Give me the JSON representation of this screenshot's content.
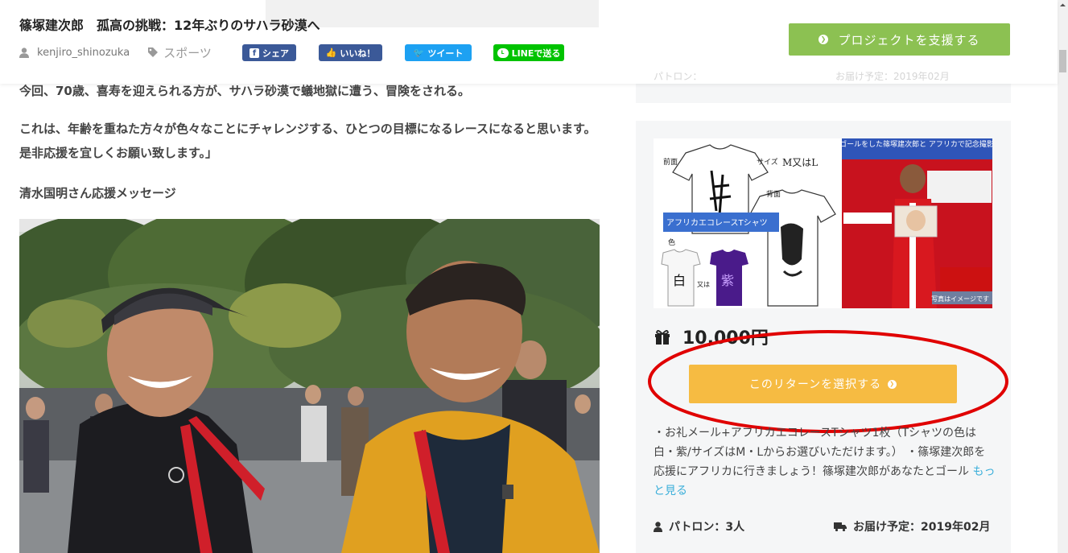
{
  "header": {
    "title": "篠塚建次郎　孤高の挑戦：12年ぶりのサハラ砂漠へ",
    "author": "kenjiro_shinozuka",
    "category": "スポーツ",
    "share_facebook": "シェア",
    "share_like": "いいね！",
    "share_tweet": "ツイート",
    "share_line": "LINEで送る",
    "support_button": "プロジェクトを支援する"
  },
  "article": {
    "paragraph1": "今回、70歳、喜寿を迎えられる方が、サハラ砂漠で蟻地獄に遭う、冒険をされる。",
    "paragraph2": "これは、年齢を重ねた方々が色々なことにチャレンジする、ひとつの目標になるレースになると思います。是非応援を宜しくお願い致します。」",
    "subheading": "清水国明さん応援メッセージ"
  },
  "sidebar_faded": {
    "text": "",
    "patron": "パトロン：",
    "delivery": "お届け予定：2019年02月"
  },
  "reward": {
    "image": {
      "front_label": "前面",
      "size_label": "サイズ",
      "size_value": "M又はL",
      "back_label": "背面",
      "shirt_banner": "アフリカエコレースTシャツ",
      "color_label": "色",
      "white_char": "白",
      "or_label": "又は",
      "purple_char": "紫",
      "photo_banner": "ゴールをした篠塚建次郎と アフリカで記念撮影",
      "photo_caption": "写真はイメージです"
    },
    "price": "10,000円",
    "select_button": "このリターンを選択する",
    "description": "・お礼メール+アフリカエコレースTシャツ1枚（Tシャツの色は白・紫/サイズはM・Lからお選びいただけます。） ・篠塚建次郎を応援にアフリカに行きましょう！篠塚建次郎があなたとゴール",
    "more_link": "もっと見る",
    "patron": "パトロン：3人",
    "delivery": "お届け予定：2019年02月"
  },
  "colors": {
    "support_green": "#8cc152",
    "select_orange": "#f6bb42",
    "facebook_blue": "#3b5998",
    "twitter_blue": "#1da1f2",
    "line_green": "#00c300",
    "annotation_red": "#e00000",
    "link_blue": "#3bafda"
  }
}
